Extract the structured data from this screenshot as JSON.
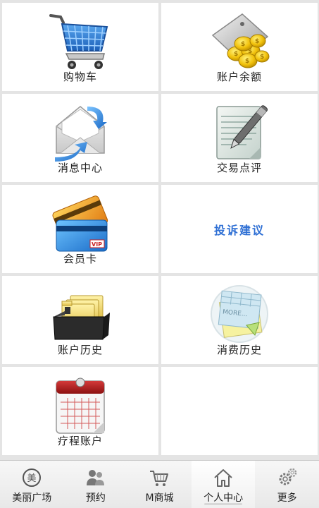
{
  "tiles": [
    {
      "label": "购物车",
      "icon": "shopping-cart-icon"
    },
    {
      "label": "账户余额",
      "icon": "coins-icon"
    },
    {
      "label": "消息中心",
      "icon": "envelope-icon"
    },
    {
      "label": "交易点评",
      "icon": "notepad-pen-icon"
    },
    {
      "label": "会员卡",
      "icon": "credit-cards-icon",
      "card_badge": "VIP"
    },
    {
      "label": "投诉建议",
      "icon": ""
    },
    {
      "label": "账户历史",
      "icon": "file-box-icon"
    },
    {
      "label": "消费历史",
      "icon": "notes-icon",
      "note_text": "MORE..."
    },
    {
      "label": "疗程账户",
      "icon": "calendar-icon"
    }
  ],
  "tabbar": {
    "items": [
      {
        "label": "美丽广场",
        "icon": "mei-circle-icon",
        "glyph": "美",
        "active": false
      },
      {
        "label": "预约",
        "icon": "people-icon",
        "active": false
      },
      {
        "label": "M商城",
        "icon": "basket-icon",
        "active": false
      },
      {
        "label": "个人中心",
        "icon": "home-icon",
        "active": true
      },
      {
        "label": "更多",
        "icon": "gears-icon",
        "active": false
      }
    ]
  },
  "colors": {
    "accent_text": "#2e6fd4",
    "background": "#e4e4e4",
    "tile": "#ffffff"
  }
}
